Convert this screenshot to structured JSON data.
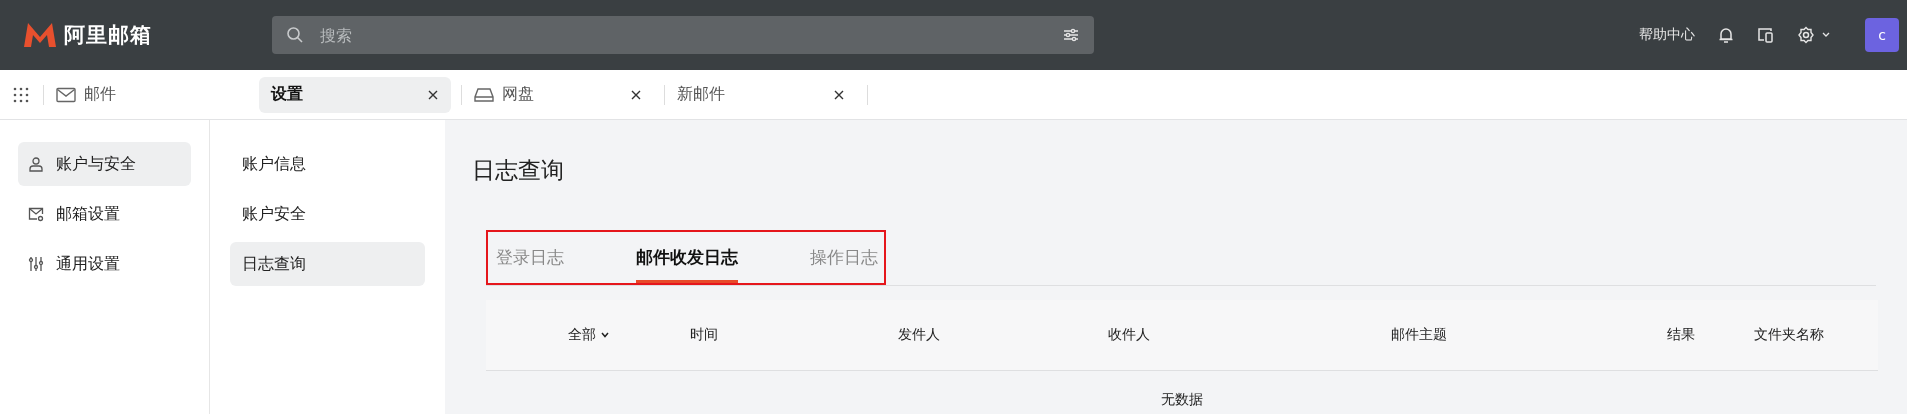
{
  "brand": {
    "name": "阿里邮箱"
  },
  "search": {
    "placeholder": "搜索"
  },
  "header_links": [
    {
      "label": "帮助中心"
    }
  ],
  "avatar": {
    "initial": "c"
  },
  "app_tabs": [
    {
      "kind": "pinned",
      "label": "邮件",
      "selected": false
    },
    {
      "kind": "plain",
      "label": "设置",
      "selected": true
    },
    {
      "kind": "drive",
      "label": "网盘",
      "selected": false
    },
    {
      "kind": "plain",
      "label": "新邮件",
      "selected": false
    }
  ],
  "sidebar": {
    "items": [
      {
        "label": "账户与安全",
        "selected": true
      },
      {
        "label": "邮箱设置",
        "selected": false
      },
      {
        "label": "通用设置",
        "selected": false
      }
    ]
  },
  "subnav": {
    "items": [
      {
        "label": "账户信息",
        "selected": false
      },
      {
        "label": "账户安全",
        "selected": false
      },
      {
        "label": "日志查询",
        "selected": true
      }
    ]
  },
  "page": {
    "title": "日志查询"
  },
  "log_tabs": {
    "highlighted": true,
    "items": [
      {
        "label": "登录日志",
        "selected": false
      },
      {
        "label": "邮件收发日志",
        "selected": true
      },
      {
        "label": "操作日志",
        "selected": false
      }
    ]
  },
  "table": {
    "columns": [
      {
        "label": "全部",
        "kind": "filter"
      },
      {
        "label": "时间",
        "kind": "plain"
      },
      {
        "label": "发件人",
        "kind": "plain"
      },
      {
        "label": "收件人",
        "kind": "plain"
      },
      {
        "label": "邮件主题",
        "kind": "plain"
      },
      {
        "label": "结果",
        "kind": "plain"
      },
      {
        "label": "文件夹名称",
        "kind": "plain"
      }
    ],
    "empty_text": "无数据"
  }
}
